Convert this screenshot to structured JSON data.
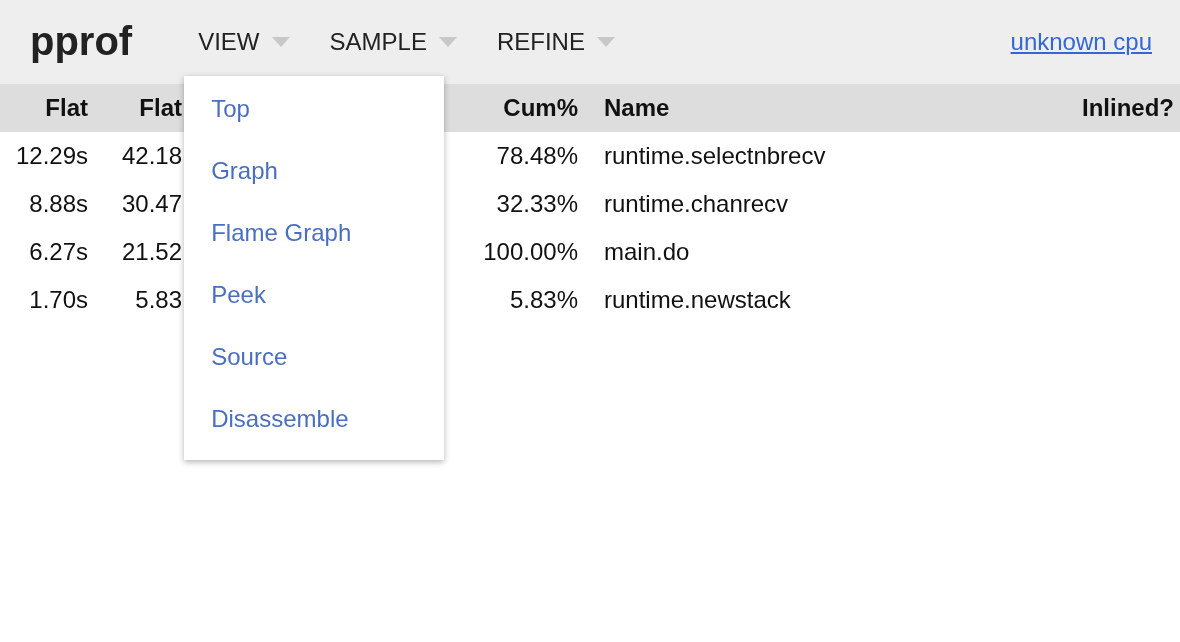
{
  "header": {
    "logo": "pprof",
    "menus": [
      "VIEW",
      "SAMPLE",
      "REFINE"
    ],
    "link": "unknown cpu"
  },
  "dropdown": {
    "items": [
      "Top",
      "Graph",
      "Flame Graph",
      "Peek",
      "Source",
      "Disassemble"
    ]
  },
  "table": {
    "columns": [
      "Flat",
      "Flat",
      "Cum%",
      "Name",
      "Inlined?"
    ],
    "rows": [
      {
        "cells": [
          "12.29s",
          "42.18",
          "78.48%",
          "runtime.selectnbrecv"
        ]
      },
      {
        "cells": [
          "8.88s",
          "30.47",
          "32.33%",
          "runtime.chanrecv"
        ]
      },
      {
        "cells": [
          "6.27s",
          "21.52",
          "100.00%",
          "main.do"
        ]
      },
      {
        "cells": [
          "1.70s",
          "5.83",
          "5.83%",
          "runtime.newstack"
        ]
      }
    ]
  }
}
